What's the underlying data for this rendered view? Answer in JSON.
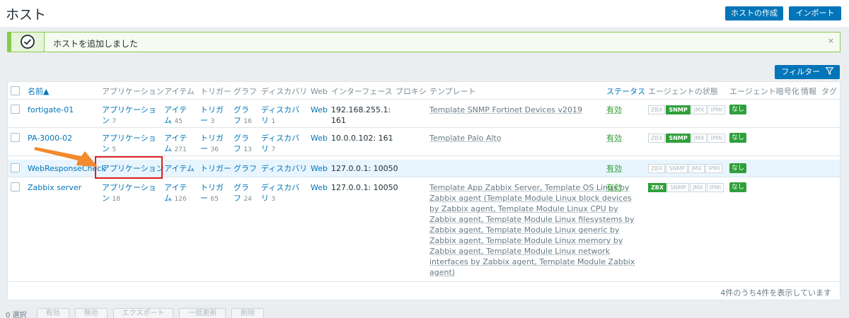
{
  "page": {
    "title": "ホスト",
    "create_button": "ホストの作成",
    "import_button": "インポート",
    "filter_button": "フィルター",
    "filter_icon": "funnel-icon"
  },
  "message": {
    "text": "ホストを追加しました",
    "icon": "check-circle-icon",
    "close": "×"
  },
  "table": {
    "headers": {
      "name": "名前▲",
      "applications": "アプリケーション",
      "items": "アイテム",
      "triggers": "トリガー",
      "graphs": "グラフ",
      "discovery": "ディスカバリ",
      "web": "Web",
      "interface": "インターフェース",
      "proxy": "プロキシ",
      "templates": "テンプレート",
      "status": "ステータス",
      "agent_status": "エージェントの状態",
      "encryption": "エージェント暗号化",
      "info": "情報",
      "tags": "タグ"
    },
    "rows": [
      {
        "name": "fortigate-01",
        "app_l1": "アプリケーショ",
        "app_l2": "ン",
        "app_count": "7",
        "item_l1": "アイテ",
        "item_l2": "ム",
        "item_count": "45",
        "trig_l1": "トリガ",
        "trig_l2": "ー",
        "trig_count": "3",
        "graph_l1": "グラ",
        "graph_l2": "フ",
        "graph_count": "16",
        "disc_l1": "ディスカバ",
        "disc_l2": "リ",
        "disc_count": "1",
        "web": "Web",
        "iface_l1": "192.168.255.1:",
        "iface_l2": "161",
        "template": "Template SNMP Fortinet Devices v2019",
        "status": "有効",
        "agents": [
          "ZBX",
          "SNMP",
          "JMX",
          "IPMI"
        ],
        "active_agent": "SNMP",
        "encryption": "なし"
      },
      {
        "name": "PA-3000-02",
        "app_l1": "アプリケーショ",
        "app_l2": "ン",
        "app_count": "5",
        "item_l1": "アイテ",
        "item_l2": "ム",
        "item_count": "271",
        "trig_l1": "トリガ",
        "trig_l2": "ー",
        "trig_count": "36",
        "graph_l1": "グラ",
        "graph_l2": "フ",
        "graph_count": "13",
        "disc_l1": "ディスカバ",
        "disc_l2": "リ",
        "disc_count": "7",
        "web": "Web",
        "iface_l1": "10.0.0.102: 161",
        "template": "Template Palo Alto",
        "status": "有効",
        "agents": [
          "ZBX",
          "SNMP",
          "JMX",
          "IPMI"
        ],
        "active_agent": "SNMP",
        "encryption": "なし"
      },
      {
        "name": "WebResponseCheck",
        "app": "アプリケーション",
        "item": "アイテム",
        "trig": "トリガー",
        "graph": "グラフ",
        "disc": "ディスカバリ",
        "web": "Web",
        "iface_l1": "127.0.0.1: 10050",
        "status": "有効",
        "agents": [
          "ZBX",
          "SNMP",
          "JMX",
          "IPMI"
        ],
        "active_agent": "",
        "encryption": "なし"
      },
      {
        "name": "Zabbix server",
        "app_l1": "アプリケーショ",
        "app_l2": "ン",
        "app_count": "18",
        "item_l1": "アイテ",
        "item_l2": "ム",
        "item_count": "126",
        "trig_l1": "トリガ",
        "trig_l2": "ー",
        "trig_count": "65",
        "graph_l1": "グラ",
        "graph_l2": "フ",
        "graph_count": "24",
        "disc_l1": "ディスカバ",
        "disc_l2": "リ",
        "disc_count": "3",
        "web": "Web",
        "iface_l1": "127.0.0.1: 10050",
        "template_lines": [
          "Template App Zabbix Server, Template OS Linux by",
          "Zabbix agent (Template Module Linux block devices",
          "by Zabbix agent, Template Module Linux CPU by",
          "Zabbix agent, Template Module Linux filesystems by",
          "Zabbix agent, Template Module Linux generic by",
          "Zabbix agent, Template Module Linux memory by",
          "Zabbix agent, Template Module Linux network",
          "interfaces by Zabbix agent, Template Module Zabbix",
          "agent)"
        ],
        "status": "有効",
        "agents": [
          "ZBX",
          "SNMP",
          "JMX",
          "IPMI"
        ],
        "active_agent": "ZBX",
        "encryption": "なし"
      }
    ],
    "footer": "4件のうち4件を表示しています"
  },
  "mass_actions": {
    "selected": "0 選択",
    "enable": "有効",
    "disable": "無効",
    "export": "エクスポート",
    "mass_update": "一括更新",
    "delete": "削除"
  },
  "colors": {
    "accent": "#0275b8",
    "success": "#2f9f3b",
    "highlight_box": "#e0201f",
    "arrow": "#f28a2e"
  }
}
